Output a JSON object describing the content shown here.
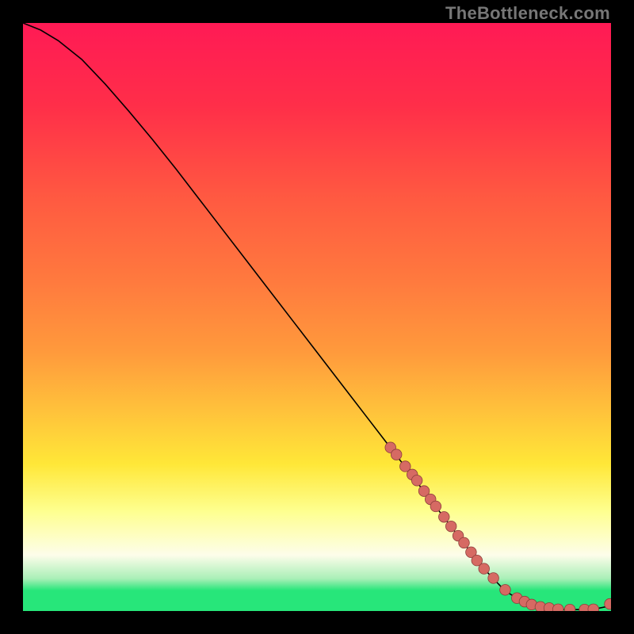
{
  "watermark": "TheBottleneck.com",
  "colors": {
    "curve": "#000000",
    "point_fill": "#d66a63",
    "point_stroke": "#8d3f3b",
    "band_green": "#27e67a",
    "band_green_pale": "#a9efb7",
    "band_white": "#fdfdea",
    "band_yellow_light": "#feff8f",
    "band_yellow": "#ffe738",
    "band_orange_light": "#ffc23b",
    "band_orange": "#ff9a3c",
    "band_orange_deep": "#ff7a3e",
    "band_red_orange": "#ff5a41",
    "band_red": "#ff2e49",
    "band_red_top": "#ff1a55"
  },
  "chart_data": {
    "type": "line",
    "title": "",
    "xlabel": "",
    "ylabel": "",
    "xlim": [
      0,
      100
    ],
    "ylim": [
      0,
      100
    ],
    "grid": false,
    "legend": false,
    "series": [
      {
        "name": "bottleneck-curve",
        "x": [
          0,
          3,
          6,
          10,
          14,
          18,
          22,
          26,
          30,
          34,
          38,
          42,
          46,
          50,
          54,
          58,
          62,
          66,
          70,
          74,
          78,
          82,
          85,
          87,
          89,
          91,
          93,
          95,
          97,
          99,
          100
        ],
        "y": [
          100,
          98.8,
          97.0,
          93.8,
          89.6,
          85.0,
          80.2,
          75.2,
          70.0,
          64.8,
          59.6,
          54.4,
          49.2,
          44.0,
          38.8,
          33.6,
          28.4,
          23.2,
          18.0,
          12.8,
          7.6,
          3.4,
          1.6,
          0.9,
          0.5,
          0.3,
          0.25,
          0.25,
          0.3,
          0.7,
          1.2
        ]
      }
    ],
    "points": {
      "name": "highlighted-samples",
      "x": [
        62.5,
        63.5,
        65.0,
        66.2,
        67.0,
        68.2,
        69.3,
        70.2,
        71.6,
        72.8,
        74.0,
        75.0,
        76.2,
        77.2,
        78.4,
        80.0,
        82.0,
        84.0,
        85.3,
        86.5,
        88.0,
        89.5,
        91.0,
        93.0,
        95.5,
        97.0,
        99.8
      ],
      "y": [
        27.8,
        26.6,
        24.6,
        23.2,
        22.2,
        20.4,
        19.0,
        17.8,
        16.0,
        14.4,
        12.8,
        11.6,
        10.0,
        8.6,
        7.2,
        5.6,
        3.6,
        2.2,
        1.6,
        1.1,
        0.7,
        0.5,
        0.3,
        0.25,
        0.25,
        0.3,
        1.2
      ]
    },
    "gradient_stops": [
      {
        "pos": 0.0,
        "key": "band_red_top"
      },
      {
        "pos": 0.14,
        "key": "band_red"
      },
      {
        "pos": 0.3,
        "key": "band_red_orange"
      },
      {
        "pos": 0.44,
        "key": "band_orange_deep"
      },
      {
        "pos": 0.56,
        "key": "band_orange"
      },
      {
        "pos": 0.66,
        "key": "band_orange_light"
      },
      {
        "pos": 0.75,
        "key": "band_yellow"
      },
      {
        "pos": 0.83,
        "key": "band_yellow_light"
      },
      {
        "pos": 0.905,
        "key": "band_white"
      },
      {
        "pos": 0.945,
        "key": "band_green_pale"
      },
      {
        "pos": 0.965,
        "key": "band_green"
      },
      {
        "pos": 1.0,
        "key": "band_green"
      }
    ]
  }
}
